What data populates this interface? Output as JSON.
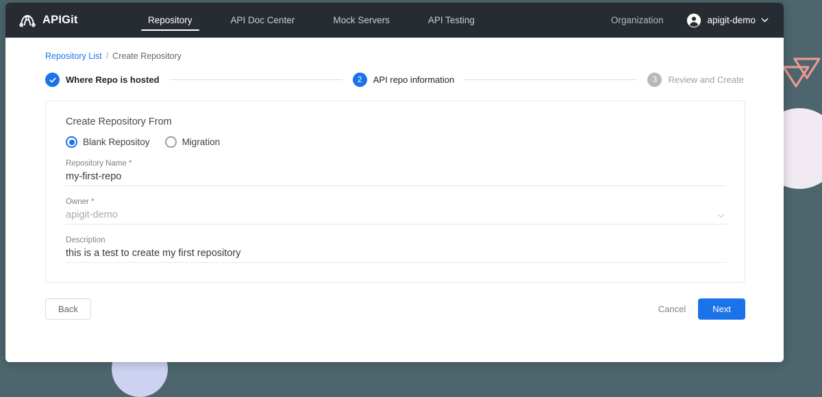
{
  "colors": {
    "accent": "#1a73e8",
    "nav_background": "#262c31",
    "page_background": "#4d656d",
    "decor_lavender": "#f2eaf3",
    "decor_periwinkle": "#ccd2f0",
    "decor_salmon": "#e79a92",
    "step_inactive": "#b4b9bd"
  },
  "nav": {
    "brand": "APIGit",
    "brand_logo_icon": "apigit-arch-logo-icon",
    "tabs": [
      {
        "label": "Repository",
        "active": true
      },
      {
        "label": "API Doc Center",
        "active": false
      },
      {
        "label": "Mock Servers",
        "active": false
      },
      {
        "label": "API Testing",
        "active": false
      }
    ],
    "organization_label": "Organization",
    "user_name": "apigit-demo",
    "user_avatar_icon": "account-circle-icon",
    "user_caret_icon": "chevron-down-icon"
  },
  "breadcrumb": {
    "link_label": "Repository List",
    "separator": "/",
    "current_label": "Create Repository"
  },
  "stepper": {
    "steps": [
      {
        "badge": "✓",
        "label": "Where Repo is hosted",
        "state": "done"
      },
      {
        "badge": "2",
        "label": "API repo information",
        "state": "active"
      },
      {
        "badge": "3",
        "label": "Review and Create",
        "state": "todo"
      }
    ]
  },
  "card": {
    "title": "Create Repository From",
    "radio_options": [
      {
        "label": "Blank Repositoy",
        "selected": true
      },
      {
        "label": "Migration",
        "selected": false
      }
    ],
    "fields": {
      "repository_name": {
        "label": "Repository Name *",
        "value": "my-first-repo",
        "placeholder": "Repository Name"
      },
      "owner": {
        "label": "Owner *",
        "value": "apigit-demo",
        "placeholder": "Owner",
        "caret_icon": "chevron-down-icon"
      },
      "description": {
        "label": "Description",
        "value": "this is a test to create my first repository",
        "placeholder": "Description"
      }
    }
  },
  "footer": {
    "back_label": "Back",
    "cancel_label": "Cancel",
    "next_label": "Next"
  }
}
